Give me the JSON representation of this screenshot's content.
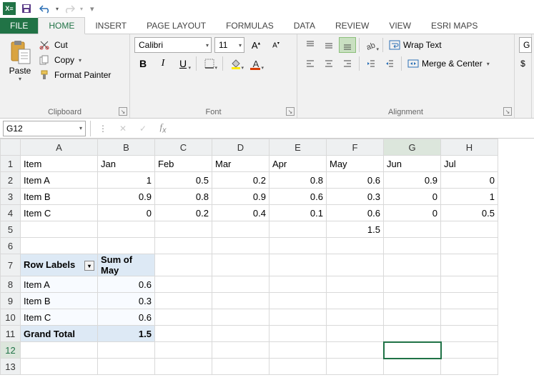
{
  "qat": {
    "save": "save",
    "undo": "undo",
    "redo": "redo"
  },
  "tabs": [
    "FILE",
    "HOME",
    "INSERT",
    "PAGE LAYOUT",
    "FORMULAS",
    "DATA",
    "REVIEW",
    "VIEW",
    "ESRI MAPS"
  ],
  "activeTab": "HOME",
  "clipboard": {
    "paste": "Paste",
    "cut": "Cut",
    "copy": "Copy",
    "painter": "Format Painter",
    "group": "Clipboard"
  },
  "font": {
    "name": "Calibri",
    "size": "11",
    "group": "Font"
  },
  "alignment": {
    "wrap": "Wrap Text",
    "merge": "Merge & Center",
    "group": "Alignment"
  },
  "namebox": "G12",
  "formula": "",
  "cols": [
    "A",
    "B",
    "C",
    "D",
    "E",
    "F",
    "G",
    "H"
  ],
  "selectedCol": "G",
  "selectedRow": 12,
  "sheet": {
    "headers": [
      "Item",
      "Jan",
      "Feb",
      "Mar",
      "Apr",
      "May",
      "Jun",
      "Jul"
    ],
    "rows": [
      [
        "Item A",
        "1",
        "0.5",
        "0.2",
        "0.8",
        "0.6",
        "0.9",
        "0"
      ],
      [
        "Item B",
        "0.9",
        "0.8",
        "0.9",
        "0.6",
        "0.3",
        "0",
        "1"
      ],
      [
        "Item C",
        "0",
        "0.2",
        "0.4",
        "0.1",
        "0.6",
        "0",
        "0.5"
      ]
    ],
    "sumMay": "1.5"
  },
  "pivot": {
    "rowLabelsHdr": "Row Labels",
    "valHdr": "Sum of May",
    "rows": [
      [
        "Item A",
        "0.6"
      ],
      [
        "Item B",
        "0.3"
      ],
      [
        "Item C",
        "0.6"
      ]
    ],
    "totalLabel": "Grand Total",
    "totalVal": "1.5"
  },
  "chart_data": {
    "type": "table",
    "title": "Sum of May by Item",
    "categories": [
      "Item A",
      "Item B",
      "Item C"
    ],
    "values": [
      0.6,
      0.3,
      0.6
    ],
    "total": 1.5
  }
}
